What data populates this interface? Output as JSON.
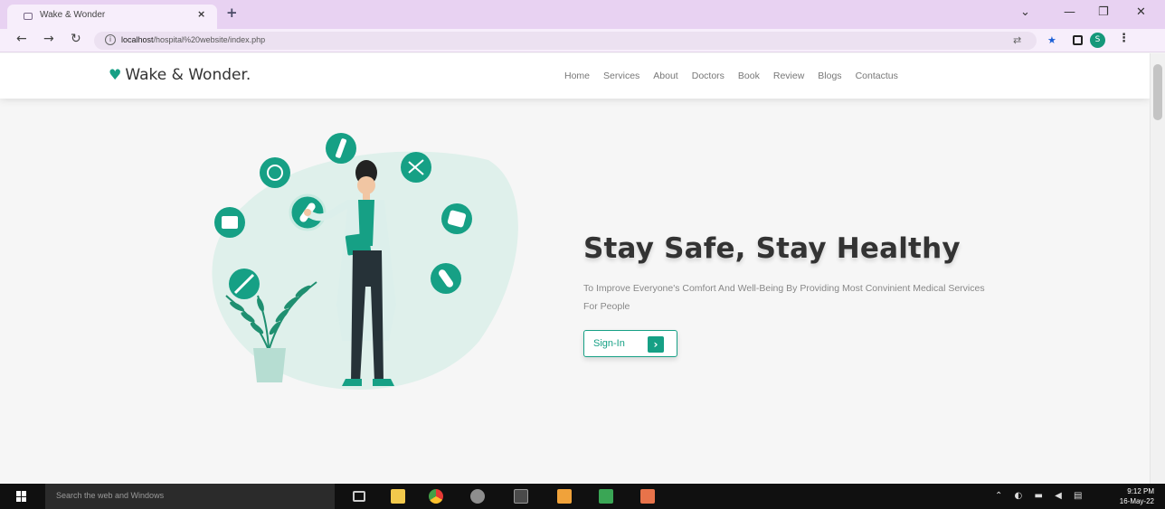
{
  "browser": {
    "tab_title": "Wake & Wonder",
    "tab_close": "×",
    "new_tab": "+",
    "url_host": "localhost",
    "url_path": "/hospital%20website/index.php",
    "window_controls": {
      "minimize": "—",
      "maximize": "❐",
      "close": "✕",
      "dropdown": "⌄"
    },
    "profile_initial": "S"
  },
  "site": {
    "brand": "Wake & Wonder.",
    "nav": [
      "Home",
      "Services",
      "About",
      "Doctors",
      "Book",
      "Review",
      "Blogs",
      "Contactus"
    ]
  },
  "hero": {
    "title": "Stay Safe, Stay Healthy",
    "subtitle": "To Improve Everyone's Comfort And Well-Being By Providing Most Convinient Medical Services For People",
    "cta_label": "Sign-In",
    "cta_arrow": "›"
  },
  "taskbar": {
    "search_placeholder": "Search the web and Windows",
    "time": "9:12 PM",
    "date": "16-May-22"
  },
  "colors": {
    "accent": "#16a085",
    "tab_bar": "#e8d2f2",
    "taskbar": "#101010"
  }
}
